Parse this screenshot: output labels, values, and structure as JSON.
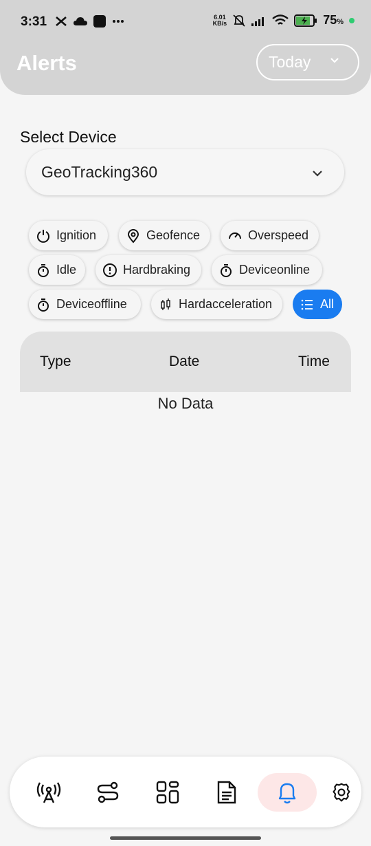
{
  "status_bar": {
    "time": "3:31",
    "left_icons": [
      "capcut-icon",
      "cloud-icon",
      "app-square-icon",
      "more-dots-icon"
    ],
    "net_speed_value": "6.01",
    "net_speed_unit": "KB/s",
    "battery_percent": "75",
    "battery_percent_sign": "%"
  },
  "header": {
    "title": "Alerts",
    "date_filter": "Today"
  },
  "device": {
    "label": "Select Device",
    "selected": "GeoTracking360"
  },
  "filters": [
    {
      "label": "Ignition",
      "icon": "power-icon"
    },
    {
      "label": "Geofence",
      "icon": "location-pin-icon"
    },
    {
      "label": "Overspeed",
      "icon": "speedometer-icon"
    },
    {
      "label": "Idle",
      "icon": "stopwatch-icon"
    },
    {
      "label": "Hardbraking",
      "icon": "alert-circle-icon"
    },
    {
      "label": "Deviceonline",
      "icon": "stopwatch-icon"
    },
    {
      "label": "Deviceoffline",
      "icon": "stopwatch-icon"
    },
    {
      "label": "Hardacceleration",
      "icon": "candlestick-icon"
    },
    {
      "label": "All",
      "icon": "list-icon",
      "active": true
    }
  ],
  "table": {
    "columns": [
      "Type",
      "Date",
      "Time"
    ],
    "empty_text": "No Data"
  },
  "bottom_nav": [
    {
      "icon": "broadcast-tower-icon"
    },
    {
      "icon": "route-icon"
    },
    {
      "icon": "dashboard-grid-icon"
    },
    {
      "icon": "report-document-icon"
    },
    {
      "icon": "bell-icon",
      "active": true
    },
    {
      "icon": "settings-gear-icon"
    }
  ],
  "colors": {
    "accent": "#1a7cf0",
    "header_bg": "#d4d4d4",
    "active_nav_bg": "#fde7e7"
  }
}
